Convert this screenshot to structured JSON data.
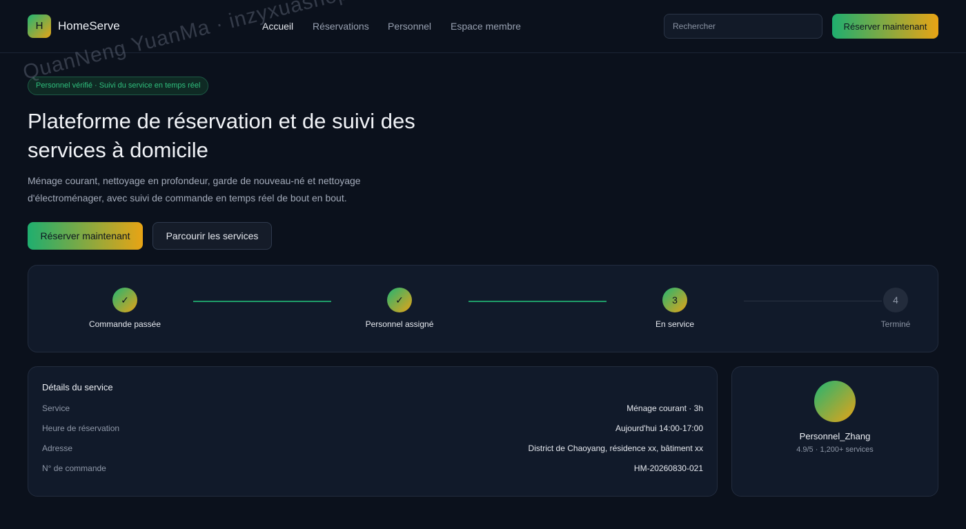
{
  "header": {
    "logo_letter": "H",
    "brand": "HomeServe",
    "nav": [
      "Accueil",
      "Réservations",
      "Personnel",
      "Espace membre"
    ],
    "search_placeholder": "Rechercher",
    "cta": "Réserver maintenant"
  },
  "hero": {
    "badge": "Personnel vérifié · Suivi du service en temps réel",
    "title": "Plateforme de réservation et de suivi des services à domicile",
    "subtitle": "Ménage courant, nettoyage en profondeur, garde de nouveau-né et nettoyage d'électroménager, avec suivi de commande en temps réel de bout en bout.",
    "primary_button": "Réserver maintenant",
    "secondary_button": "Parcourir les services"
  },
  "progress": {
    "steps": [
      {
        "marker": "✓",
        "label": "Commande passée",
        "state": "done"
      },
      {
        "marker": "✓",
        "label": "Personnel assigné",
        "state": "done"
      },
      {
        "marker": "3",
        "label": "En service",
        "state": "current"
      },
      {
        "marker": "4",
        "label": "Terminé",
        "state": "pending"
      }
    ]
  },
  "details": {
    "title": "Détails du service",
    "rows": [
      {
        "key": "Service",
        "value": "Ménage courant · 3h"
      },
      {
        "key": "Heure de réservation",
        "value": "Aujourd'hui 14:00-17:00"
      },
      {
        "key": "Adresse",
        "value": "District de Chaoyang, résidence xx, bâtiment xx"
      },
      {
        "key": "N° de commande",
        "value": "HM-20260830-021"
      }
    ]
  },
  "staff": {
    "name": "Personnel_Zhang",
    "meta": "4.9/5 · 1,200+ services"
  },
  "watermark": "QuanNeng YuanMa · inzyxuashop.com",
  "colors": {
    "background": "#0b111c",
    "card": "#111a2a",
    "accent_green": "#22b573",
    "accent_gold": "#e6a317"
  }
}
